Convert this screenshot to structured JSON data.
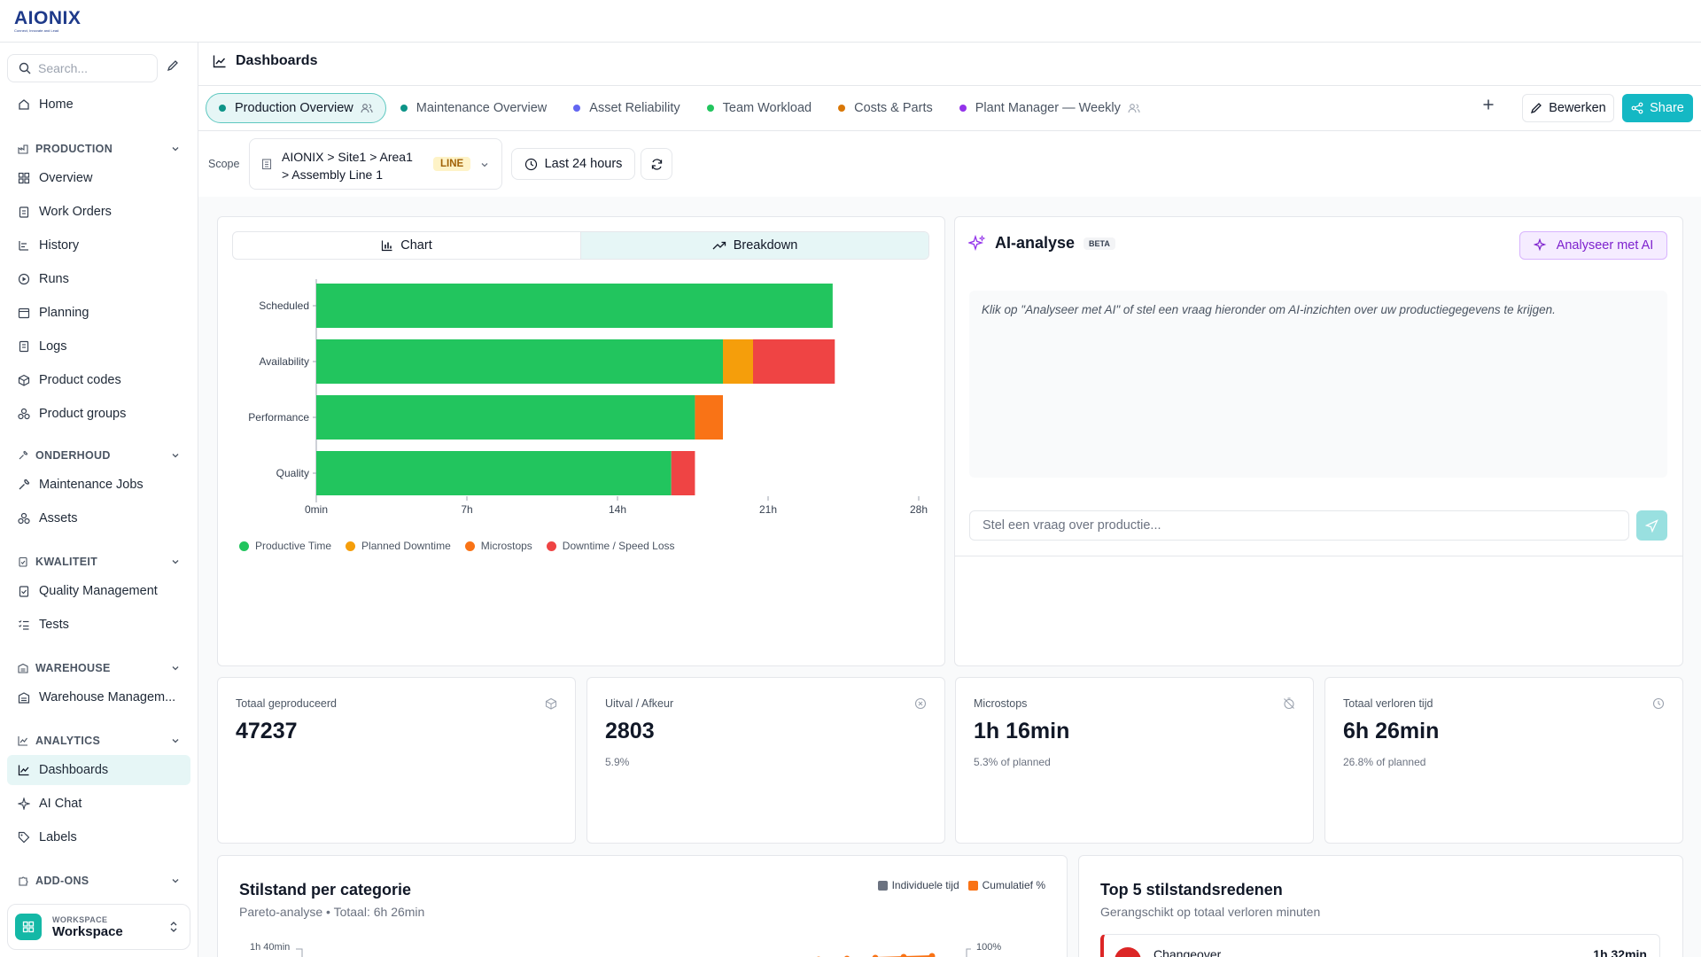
{
  "brand": {
    "name": "AIONIX",
    "tagline": "Connect, Innovate and Lead"
  },
  "sidebar": {
    "search_placeholder": "Search...",
    "home": "Home",
    "sections": {
      "production": {
        "label": "PRODUCTION",
        "items": [
          "Overview",
          "Work Orders",
          "History",
          "Runs",
          "Planning",
          "Logs",
          "Product codes",
          "Product groups"
        ]
      },
      "onderhoud": {
        "label": "ONDERHOUD",
        "items": [
          "Maintenance Jobs",
          "Assets"
        ]
      },
      "kwaliteit": {
        "label": "KWALITEIT",
        "items": [
          "Quality Management",
          "Tests"
        ]
      },
      "warehouse": {
        "label": "WAREHOUSE",
        "items": [
          "Warehouse Managem..."
        ]
      },
      "analytics": {
        "label": "ANALYTICS",
        "items": [
          "Dashboards",
          "AI Chat",
          "Labels"
        ]
      },
      "addons": {
        "label": "ADD-ONS"
      }
    },
    "workspace": {
      "small": "WORKSPACE",
      "name": "Workspace"
    }
  },
  "header": {
    "title": "Dashboards"
  },
  "tabs": [
    {
      "label": "Production Overview",
      "color": "#0d9488"
    },
    {
      "label": "Maintenance Overview",
      "color": "#0d9488"
    },
    {
      "label": "Asset Reliability",
      "color": "#6366f1"
    },
    {
      "label": "Team Workload",
      "color": "#22c55e"
    },
    {
      "label": "Costs & Parts",
      "color": "#d97706"
    },
    {
      "label": "Plant Manager — Weekly",
      "color": "#9333ea"
    }
  ],
  "actions": {
    "edit": "Bewerken",
    "share": "Share"
  },
  "filters": {
    "scope_label": "Scope",
    "scope_line1": "AIONIX > Site1 > Area1",
    "scope_line2": "> Assembly Line 1",
    "scope_badge": "LINE",
    "time_range": "Last 24 hours"
  },
  "chart_panel": {
    "view_chart": "Chart",
    "view_breakdown": "Breakdown"
  },
  "chart_data": {
    "type": "bar",
    "orientation": "horizontal",
    "stacked": true,
    "categories": [
      "Scheduled",
      "Availability",
      "Performance",
      "Quality"
    ],
    "x_ticks": [
      "0min",
      "7h",
      "14h",
      "21h",
      "28h"
    ],
    "xlim": [
      0,
      28
    ],
    "series": [
      {
        "name": "Productive Time",
        "color": "#22c55e",
        "values": [
          24,
          18.9,
          17.6,
          16.5
        ]
      },
      {
        "name": "Planned Downtime",
        "color": "#f59e0b",
        "values": [
          0,
          1.4,
          0,
          0
        ]
      },
      {
        "name": "Microstops",
        "color": "#f97316",
        "values": [
          0,
          0,
          1.3,
          0
        ]
      },
      {
        "name": "Downtime / Speed Loss",
        "color": "#ef4444",
        "values": [
          0,
          3.8,
          0,
          1.1
        ]
      }
    ],
    "legend_position": "bottom"
  },
  "ai": {
    "title": "AI-analyse",
    "badge": "BETA",
    "button": "Analyseer met AI",
    "hint": "Klik op \"Analyseer met AI\" of stel een vraag hieronder om AI-inzichten over uw productiegegevens te krijgen.",
    "input_placeholder": "Stel een vraag over productie..."
  },
  "kpis": [
    {
      "label": "Totaal geproduceerd",
      "value": "47237",
      "sub": ""
    },
    {
      "label": "Uitval / Afkeur",
      "value": "2803",
      "sub": "5.9%"
    },
    {
      "label": "Microstops",
      "value": "1h 16min",
      "sub": "5.3% of planned"
    },
    {
      "label": "Totaal verloren tijd",
      "value": "6h 26min",
      "sub": "26.8% of planned"
    }
  ],
  "pareto": {
    "title": "Stilstand per categorie",
    "subtitle": "Pareto-analyse • Totaal: 6h 26min",
    "legend_individual": "Individuele tijd",
    "legend_cumulative": "Cumulatief %",
    "y_left_top": "1h 40min",
    "y_right_top": "100%",
    "colors": {
      "individual": "#6b7280",
      "cumulative": "#f97316"
    }
  },
  "top5": {
    "title": "Top 5 stilstandsredenen",
    "subtitle": "Gerangschikt op totaal verloren minuten",
    "first": {
      "name": "Changeover",
      "value": "1h 32min"
    }
  }
}
